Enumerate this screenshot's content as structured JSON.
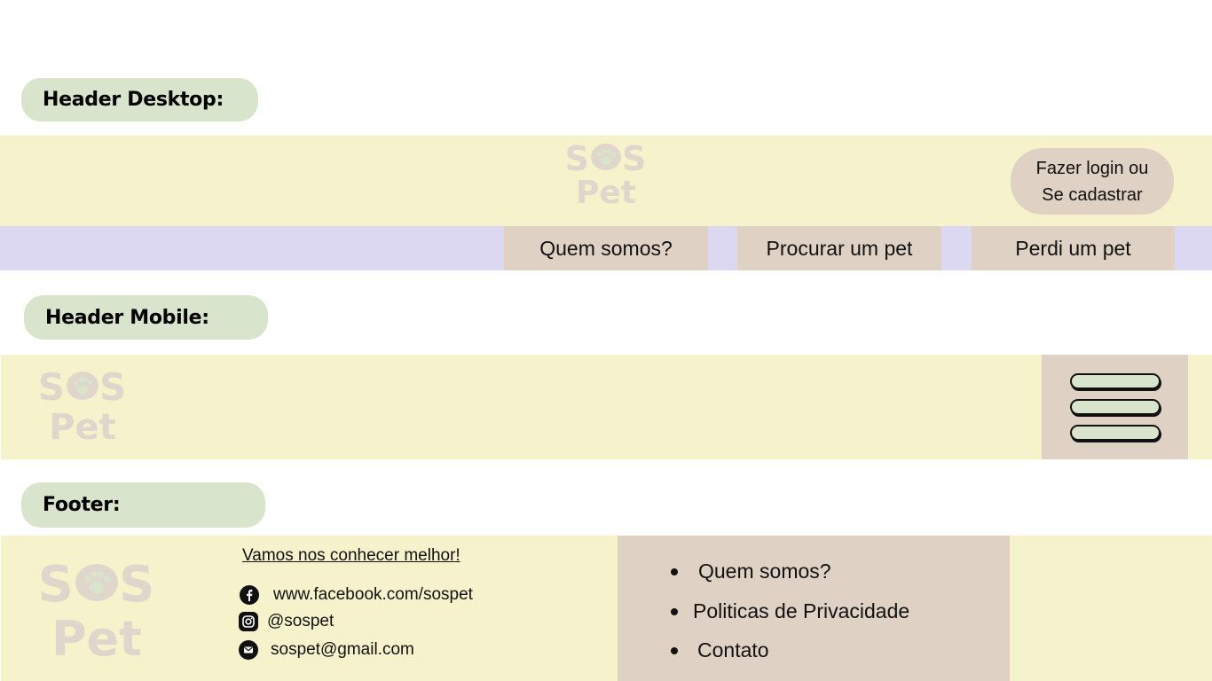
{
  "labels": {
    "header_desktop": "Header Desktop:",
    "header_mobile": "Header Mobile:",
    "footer": "Footer:"
  },
  "logo": {
    "line1_a": "S",
    "line1_b": "S",
    "line2": "Pet"
  },
  "header_desktop": {
    "login_line1": "Fazer login ou",
    "login_line2": "Se cadastrar",
    "nav": [
      "Quem somos?",
      "Procurar um pet",
      "Perdi um pet"
    ]
  },
  "header_mobile": {
    "menu_icon": "hamburger-icon"
  },
  "footer": {
    "heading": "Vamos nos conhecer melhor!",
    "contacts": [
      {
        "icon": "facebook-icon",
        "text": "www.facebook.com/sospet"
      },
      {
        "icon": "instagram-icon",
        "text": "@sospet"
      },
      {
        "icon": "email-icon",
        "text": "sospet@gmail.com"
      }
    ],
    "links": [
      "Quem somos?",
      "Politicas de Privacidade",
      "Contato"
    ]
  },
  "colors": {
    "label_pill": "#d8e4cb",
    "band_yellow": "#f6f2cb",
    "band_purple": "#dcd8f2",
    "tan": "#dfd2c4",
    "logo": "#e1d6cb",
    "paw": "#d8e4cb"
  }
}
